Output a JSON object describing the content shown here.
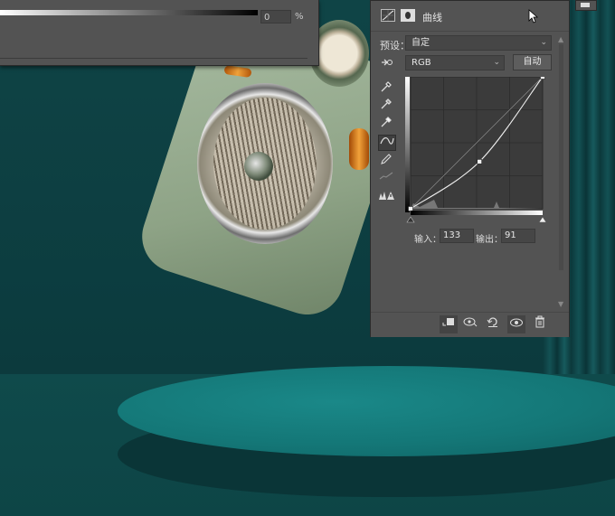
{
  "dialog": {
    "opacity_value": "0",
    "opacity_unit": "%"
  },
  "panel": {
    "title": "曲线",
    "preset_label": "预设：",
    "preset_value": "自定",
    "channel_value": "RGB",
    "auto_button": "自动",
    "input_label": "输入：",
    "input_value": "133",
    "output_label": "输出：",
    "output_value": "91",
    "icons": {
      "header": [
        "curves-adjustment-icon",
        "layer-mask-icon"
      ],
      "tools": [
        "hand-target-icon",
        "black-eyedropper-icon",
        "gray-eyedropper-icon",
        "white-eyedropper-icon",
        "curve-edit-icon",
        "pencil-icon",
        "smooth-icon",
        "clipping-warning-icon"
      ],
      "footer": [
        "clip-to-layer-icon",
        "view-previous-state-icon",
        "reset-icon",
        "visibility-eye-icon",
        "trash-icon"
      ]
    }
  },
  "chart_data": {
    "type": "line",
    "xlim": [
      0,
      255
    ],
    "ylim": [
      0,
      255
    ],
    "grid": true,
    "series": [
      {
        "points": [
          [
            0,
            0
          ],
          [
            133,
            91
          ],
          [
            255,
            255
          ]
        ]
      }
    ],
    "baseline": [
      [
        0,
        0
      ],
      [
        255,
        255
      ]
    ]
  },
  "colors": {
    "panel_bg": "#535353",
    "field_bg": "#464646",
    "graph_bg": "#3b3b3b",
    "scene_teal": "#147777"
  }
}
